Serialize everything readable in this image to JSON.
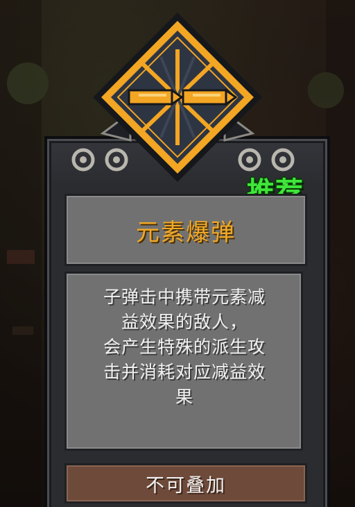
{
  "card": {
    "title": "元素爆弹",
    "description_lines": [
      "子弹击中携带元素减",
      "益效果的敌人，",
      "会产生特殊的派生攻",
      "击并消耗对应减益效",
      "果"
    ],
    "stack_label": "不可叠加",
    "recommend_badge": "推荐",
    "emblem_icon": "crossed-bullets-icon"
  },
  "colors": {
    "title": "#f0a826",
    "panel": "#717171",
    "stack_panel": "#6e4a3a",
    "recommend": "#3fe63a",
    "emblem_gold": "#f2a623",
    "emblem_dark": "#2e3542"
  }
}
